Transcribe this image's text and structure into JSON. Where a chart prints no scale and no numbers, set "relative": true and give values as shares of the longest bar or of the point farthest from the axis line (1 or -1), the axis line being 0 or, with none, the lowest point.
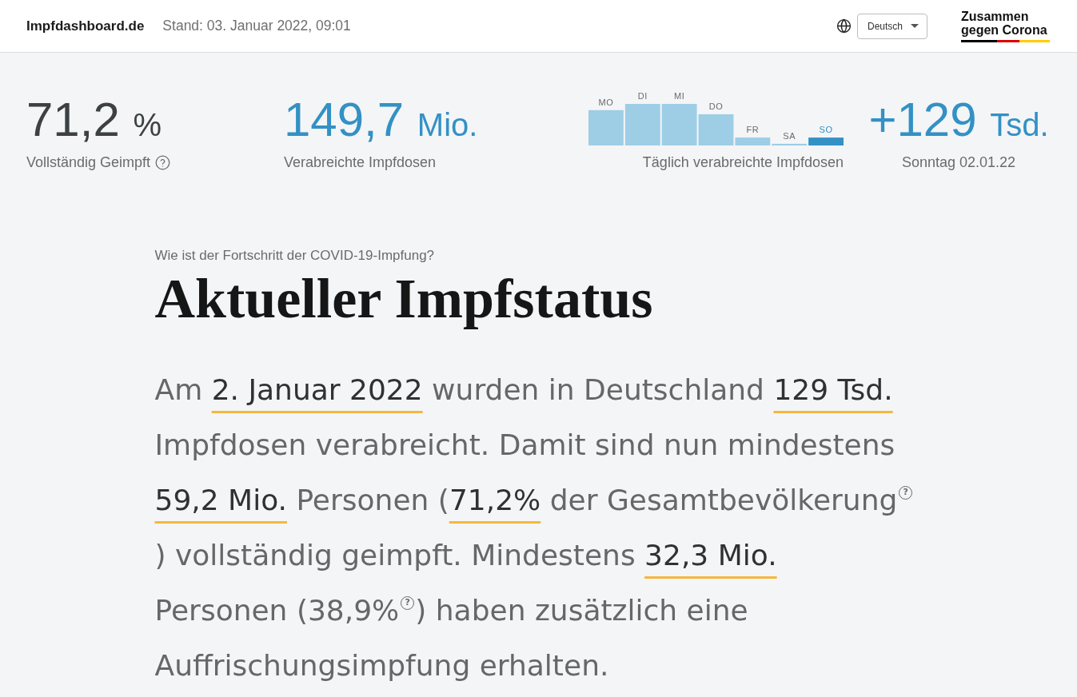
{
  "header": {
    "site_name": "Impfdashboard.de",
    "timestamp": "Stand: 03. Januar 2022, 09:01",
    "language": "Deutsch",
    "logo_lines": [
      "Zusammen",
      "gegen Corona"
    ]
  },
  "figures": [
    {
      "kind": "figure",
      "value": "71,2",
      "unit": "%",
      "label": "Vollständig Geimpft",
      "help": true,
      "color": "#3b4144"
    },
    {
      "kind": "figure",
      "value": "149,7",
      "unit": "Mio.",
      "label": "Verabreichte Impfdosen",
      "help": false,
      "color": "#3391c4"
    },
    {
      "kind": "chart",
      "label": "Täglich verabreichte Impfdosen",
      "bars": [
        {
          "selected": false
        },
        {
          "selected": false
        },
        {
          "selected": false
        },
        {
          "selected": false
        },
        {
          "selected": false
        },
        {
          "selected": false
        },
        {
          "selected": true
        }
      ],
      "chart_data": {
        "type": "bar",
        "relative": true,
        "categories": [
          "MO",
          "DI",
          "MI",
          "DO",
          "FR",
          "SA",
          "SO"
        ],
        "values": [
          0.85,
          1,
          1,
          0.75,
          0.19,
          0.04,
          0.19
        ]
      }
    },
    {
      "kind": "figure",
      "value": "+129",
      "unit": "Tsd.",
      "label": "Sonntag 02.01.22",
      "help": false,
      "color": "#3391c4"
    }
  ],
  "status": {
    "kicker": "Wie ist der Fortschritt der COVID-19-Impfung?",
    "title": "Aktueller Impfstatus",
    "summary": [
      {
        "kind": "plain",
        "text": "Am "
      },
      {
        "kind": "highlight",
        "text": "2. Januar 2022"
      },
      {
        "kind": "plain",
        "text": " wurden in Deutschland "
      },
      {
        "kind": "highlight",
        "text": "129 Tsd."
      },
      {
        "kind": "plain",
        "text": " Impfdosen verabreicht. Damit sind nun mindestens "
      },
      {
        "kind": "highlight",
        "text": "59,2 Mio."
      },
      {
        "kind": "plain",
        "text": " Personen ("
      },
      {
        "kind": "highlight",
        "text": "71,2%"
      },
      {
        "kind": "plain",
        "text": " der Gesamtbevölkerung"
      },
      {
        "kind": "help",
        "text": "?"
      },
      {
        "kind": "plain",
        "text": ") vollständig geimpft. Mindestens "
      },
      {
        "kind": "highlight",
        "text": "32,3 Mio."
      },
      {
        "kind": "plain",
        "text": " Personen (38,9%"
      },
      {
        "kind": "help",
        "text": "?"
      },
      {
        "kind": "plain",
        "text": ") haben zusätzlich eine Auffrischungsimpfung erhalten."
      }
    ]
  }
}
